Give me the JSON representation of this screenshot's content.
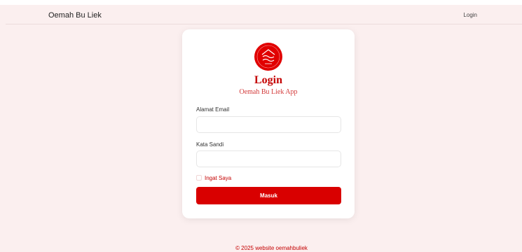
{
  "navbar": {
    "brand": "Oemah Bu Liek",
    "login_link": "Login"
  },
  "card": {
    "logo_icon": "oemah-bu-liek-logo",
    "title": "Login",
    "subtitle": "Oemah Bu Liek App",
    "email_label": "Alamat Email",
    "email_value": "",
    "password_label": "Kata Sandi",
    "password_value": "",
    "remember_label": "Ingat Saya",
    "submit_label": "Masuk"
  },
  "footer": {
    "text": "© 2025 website oemahbuliek"
  },
  "colors": {
    "background": "#fbefef",
    "accent": "#d90000",
    "accent_text": "#c40000"
  }
}
